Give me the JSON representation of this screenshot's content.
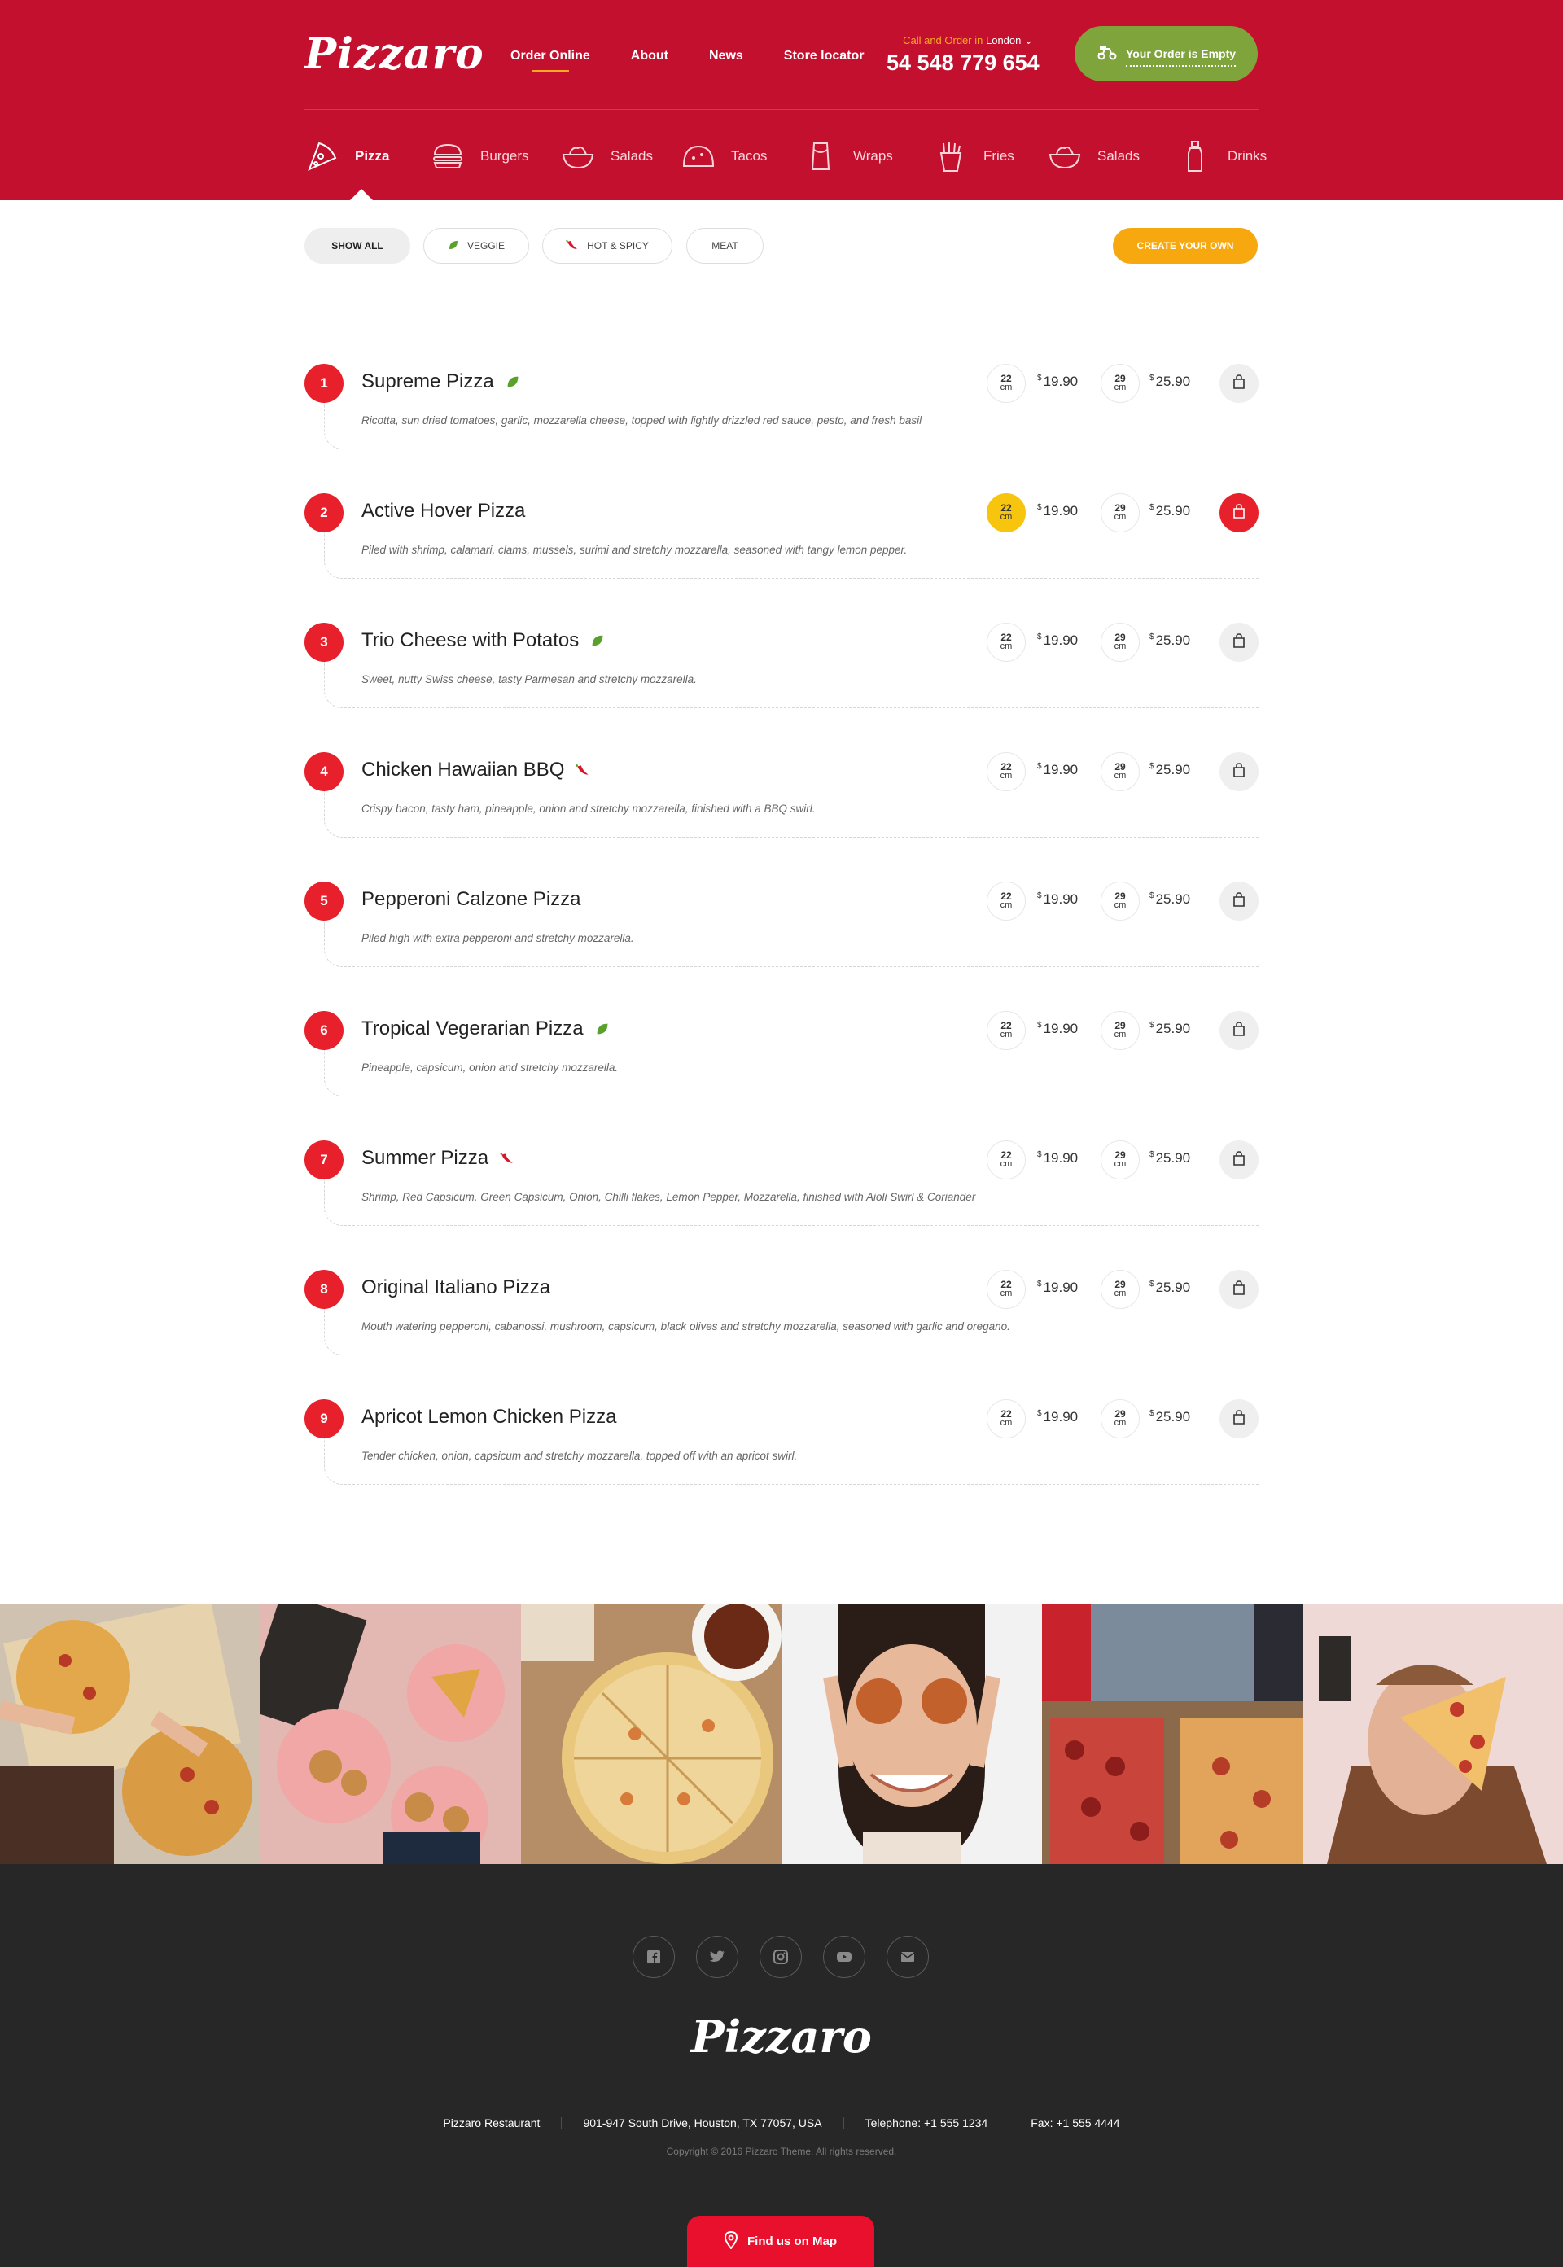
{
  "header": {
    "logo": "Pizzaro",
    "nav": [
      "Order Online",
      "About",
      "News",
      "Store locator"
    ],
    "call_prefix": "Call and Order in",
    "city": "London",
    "phone": "54 548 779 654",
    "order_button": "Your Order is Empty"
  },
  "categories": [
    "Pizza",
    "Burgers",
    "Salads",
    "Tacos",
    "Wraps",
    "Fries",
    "Salads",
    "Drinks"
  ],
  "filters": {
    "chips": [
      "Show All",
      "Veggie",
      "Hot & Spicy",
      "Meat"
    ],
    "create_button": "Create Your Own"
  },
  "sizes": {
    "small": "22",
    "large": "29",
    "unit": "cm",
    "currency": "$"
  },
  "menu": [
    {
      "num": "1",
      "name": "Supreme Pizza",
      "tag": "veggie",
      "desc": "Ricotta, sun dried tomatoes, garlic, mozzarella cheese, topped with lightly drizzled red sauce, pesto, and fresh basil",
      "price_small": "19.90",
      "price_large": "25.90",
      "active": false
    },
    {
      "num": "2",
      "name": "Active Hover Pizza",
      "tag": "",
      "desc": "Piled with shrimp, calamari, clams, mussels, surimi and stretchy mozzarella, seasoned with tangy lemon pepper.",
      "price_small": "19.90",
      "price_large": "25.90",
      "active": true
    },
    {
      "num": "3",
      "name": "Trio Cheese with Potatos",
      "tag": "veggie",
      "desc": "Sweet, nutty Swiss cheese, tasty Parmesan and stretchy mozzarella.",
      "price_small": "19.90",
      "price_large": "25.90",
      "active": false
    },
    {
      "num": "4",
      "name": "Chicken Hawaiian BBQ",
      "tag": "spicy",
      "desc": "Crispy bacon, tasty ham, pineapple, onion and stretchy mozzarella, finished with a BBQ swirl.",
      "price_small": "19.90",
      "price_large": "25.90",
      "active": false
    },
    {
      "num": "5",
      "name": "Pepperoni Calzone Pizza",
      "tag": "",
      "desc": "Piled high with extra pepperoni and stretchy mozzarella.",
      "price_small": "19.90",
      "price_large": "25.90",
      "active": false
    },
    {
      "num": "6",
      "name": "Tropical Vegerarian Pizza",
      "tag": "veggie",
      "desc": "Pineapple, capsicum, onion and stretchy mozzarella.",
      "price_small": "19.90",
      "price_large": "25.90",
      "active": false
    },
    {
      "num": "7",
      "name": "Summer Pizza",
      "tag": "spicy",
      "desc": "Shrimp, Red Capsicum, Green Capsicum, Onion, Chilli flakes, Lemon Pepper, Mozzarella, finished with Aioli Swirl & Coriander",
      "price_small": "19.90",
      "price_large": "25.90",
      "active": false
    },
    {
      "num": "8",
      "name": "Original Italiano Pizza",
      "tag": "",
      "desc": "Mouth watering pepperoni, cabanossi, mushroom, capsicum, black olives and stretchy mozzarella, seasoned with garlic and oregano.",
      "price_small": "19.90",
      "price_large": "25.90",
      "active": false
    },
    {
      "num": "9",
      "name": "Apricot Lemon Chicken Pizza",
      "tag": "",
      "desc": "Tender chicken, onion, capsicum and stretchy mozzarella, topped off with an apricot swirl.",
      "price_small": "19.90",
      "price_large": "25.90",
      "active": false
    }
  ],
  "gallery": [
    "pizza-party-photo",
    "pizza-plates-photo",
    "pizza-wings-photo",
    "woman-food-eyes-photo",
    "pepperoni-box-photo",
    "man-eating-slice-photo"
  ],
  "footer": {
    "socials": [
      "facebook-icon",
      "twitter-icon",
      "instagram-icon",
      "youtube-icon",
      "email-icon"
    ],
    "logo": "Pizzaro",
    "info": [
      "Pizzaro Restaurant",
      "901-947 South Drive, Houston, TX 77057, USA",
      "Telephone: +1 555 1234",
      "Fax: +1 555 4444"
    ],
    "copyright": "Copyright © 2016 Pizzaro Theme. All rights reserved.",
    "map_button": "Find us on Map"
  },
  "colors": {
    "brand_red": "#c4102f",
    "accent_red": "#e8202c",
    "accent_orange": "#f7a80e",
    "accent_yellow": "#f7c40e",
    "order_green": "#7fa43b",
    "footer_bg": "#272727"
  }
}
